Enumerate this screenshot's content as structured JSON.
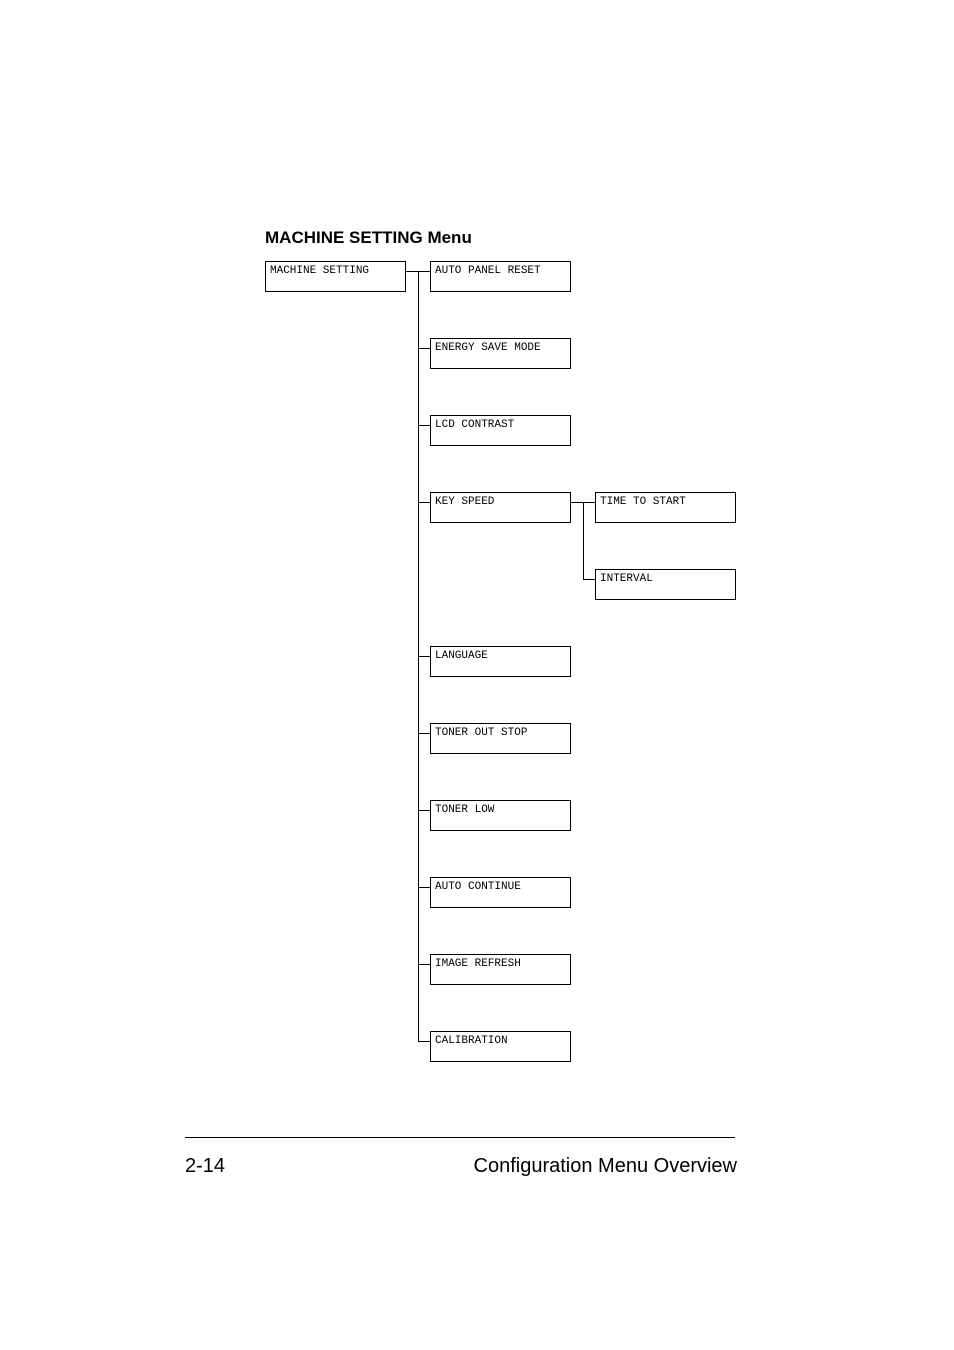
{
  "heading": "MACHINE SETTING Menu",
  "root_box": "MACHINE SETTING",
  "level2": {
    "auto_panel_reset": "AUTO PANEL RESET",
    "energy_save_mode": "ENERGY SAVE MODE",
    "lcd_contrast": "LCD CONTRAST",
    "key_speed": "KEY SPEED",
    "language": "LANGUAGE",
    "toner_out_stop": "TONER OUT STOP",
    "toner_low": "TONER LOW",
    "auto_continue": "AUTO CONTINUE",
    "image_refresh": "IMAGE REFRESH",
    "calibration": "CALIBRATION"
  },
  "level3": {
    "time_to_start": "TIME TO START",
    "interval": "INTERVAL"
  },
  "footer": {
    "page": "2-14",
    "title": "Configuration Menu Overview"
  }
}
